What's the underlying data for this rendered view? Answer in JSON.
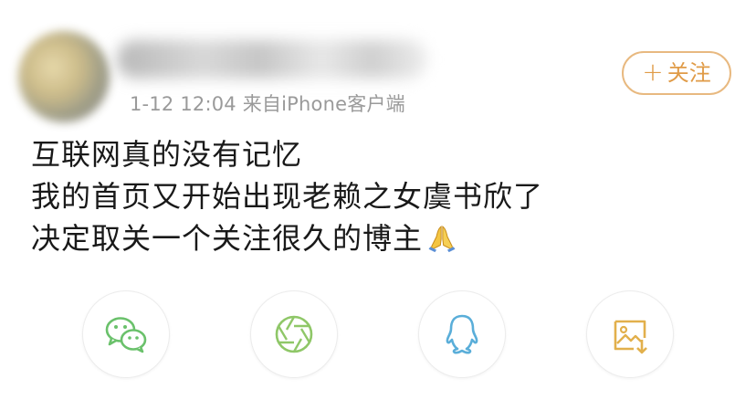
{
  "post": {
    "meta": "1-12 12:04  来自iPhone客户端",
    "follow_label": "关注",
    "follow_icon": "plus",
    "lines": [
      "互联网真的没有记忆",
      "我的首页又开始出现老赖之女虞书欣了",
      "决定取关一个关注很久的博主"
    ],
    "emoji_name": "pray-hands-icon"
  },
  "share": {
    "items": [
      {
        "icon": "wechat-icon",
        "color": "#6ac16b"
      },
      {
        "icon": "moments-icon",
        "color": "#8fc768"
      },
      {
        "icon": "qq-icon",
        "color": "#5aaed9"
      },
      {
        "icon": "save-image-icon",
        "color": "#e2b04c"
      }
    ]
  }
}
